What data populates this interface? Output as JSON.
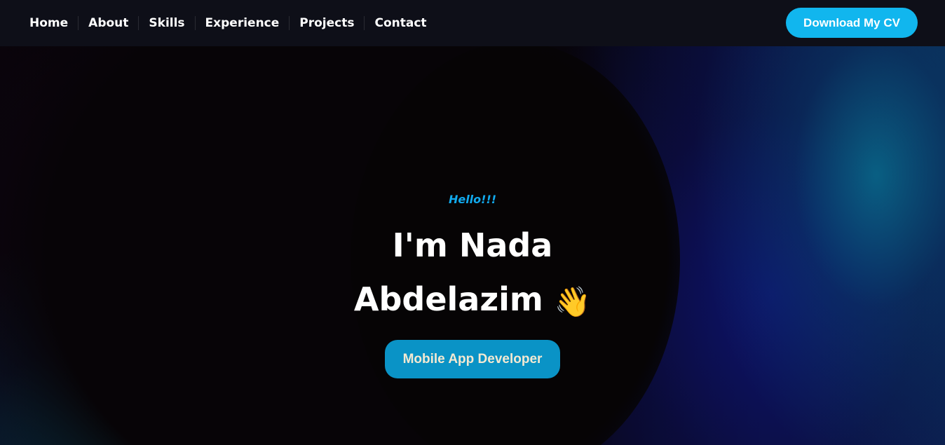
{
  "nav": {
    "links": [
      "Home",
      "About",
      "Skills",
      "Experience",
      "Projects",
      "Contact"
    ],
    "cv_button": "Download My CV"
  },
  "hero": {
    "greeting": "Hello!!!",
    "name_line1": "I'm Nada",
    "name_line2": "Abdelazim",
    "wave_emoji": "👋",
    "role_button": "Mobile App Developer"
  },
  "colors": {
    "accent": "#11b6ee",
    "navbar_bg": "#0e0f18",
    "role_button_bg": "#0a93c6"
  }
}
